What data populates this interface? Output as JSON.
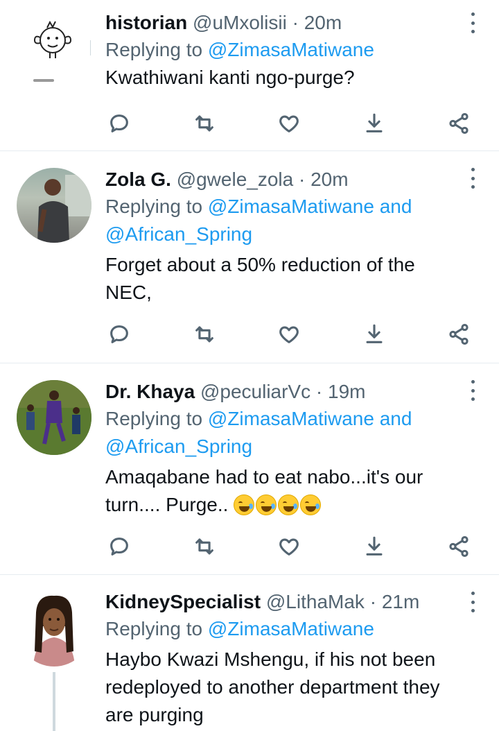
{
  "tweets": [
    {
      "display_name": "historian",
      "handle": "@uMxolisii",
      "time": "20m",
      "reply_prefix": "Replying to",
      "reply_mentions": "@ZimasaMatiwane",
      "text": [
        "Kwathiwani kanti ngo-purge?"
      ]
    },
    {
      "display_name": "Zola G.",
      "handle": "@gwele_zola",
      "time": "20m",
      "reply_prefix": "Replying to",
      "reply_mentions": "@ZimasaMatiwane",
      "reply_and": "and",
      "reply_mentions2": "@African_Spring",
      "text": [
        "Forget about a 50% reduction of the",
        "NEC,"
      ]
    },
    {
      "display_name": "Dr. Khaya",
      "handle": "@peculiarVc",
      "time": "19m",
      "reply_prefix": "Replying to",
      "reply_mentions": "@ZimasaMatiwane",
      "reply_and": "and",
      "reply_mentions2": "@African_Spring",
      "text": [
        "Amaqabane had to eat nabo...it's our",
        "turn.... Purge.."
      ]
    },
    {
      "display_name": "KidneySpecialist",
      "handle": "@LithaMak",
      "time": "21m",
      "reply_prefix": "Replying to",
      "reply_mentions": "@ZimasaMatiwane",
      "text": [
        "Haybo Kwazi Mshengu, if his not been",
        "redeployed to another department they",
        "are purging"
      ]
    }
  ],
  "dot_separator": "·",
  "emoji_names": [
    "rolling-on-floor-laughing-icon",
    "rolling-on-floor-laughing-icon",
    "rolling-on-floor-laughing-icon",
    "tears-of-joy-icon"
  ],
  "colors": {
    "link": "#1d9bf0",
    "secondary": "#536471",
    "text": "#0f1419",
    "divider": "#e6ecf0"
  }
}
